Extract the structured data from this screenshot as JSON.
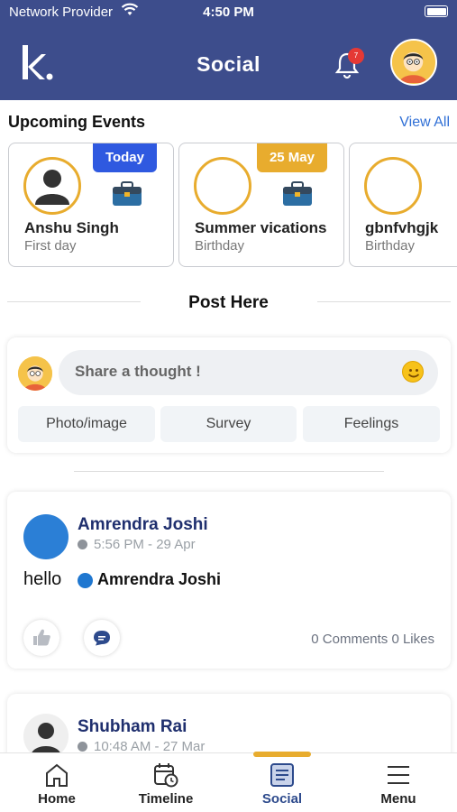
{
  "status_bar": {
    "provider": "Network Provider",
    "time": "4:50 PM"
  },
  "header": {
    "logo_text": "k.",
    "title": "Social",
    "notification_count": "7"
  },
  "events": {
    "title": "Upcoming Events",
    "view_all": "View All",
    "items": [
      {
        "tag": "Today",
        "tag_color": "#2f59e0",
        "name": "Anshu Singh",
        "subtitle": "First day",
        "has_photo": true
      },
      {
        "tag": "25 May",
        "tag_color": "#e8ac2e",
        "name": "Summer vications",
        "subtitle": "Birthday",
        "has_photo": false
      },
      {
        "tag": "",
        "tag_color": "#e8ac2e",
        "name": "gbnfvhgjk",
        "subtitle": "Birthday",
        "has_photo": false
      }
    ]
  },
  "composer": {
    "heading": "Post Here",
    "placeholder": "Share a thought !",
    "options": [
      "Photo/image",
      "Survey",
      "Feelings"
    ]
  },
  "posts": [
    {
      "author": "Amrendra Joshi",
      "time": "5:56 PM - 29 Apr",
      "text": "hello",
      "mention": "Amrendra Joshi",
      "stats": "0 Comments 0 Likes"
    },
    {
      "author": "Shubham Rai",
      "time": "10:48 AM - 27 Mar"
    }
  ],
  "nav": {
    "items": [
      {
        "label": "Home",
        "icon": "home-icon"
      },
      {
        "label": "Timeline",
        "icon": "calendar-clock-icon"
      },
      {
        "label": "Social",
        "icon": "social-feed-icon",
        "active": true
      },
      {
        "label": "Menu",
        "icon": "menu-icon"
      }
    ]
  },
  "colors": {
    "header": "#3d4d8c",
    "accent": "#e8ac2e",
    "link": "#2f6fd6",
    "author": "#1f2f6e"
  }
}
